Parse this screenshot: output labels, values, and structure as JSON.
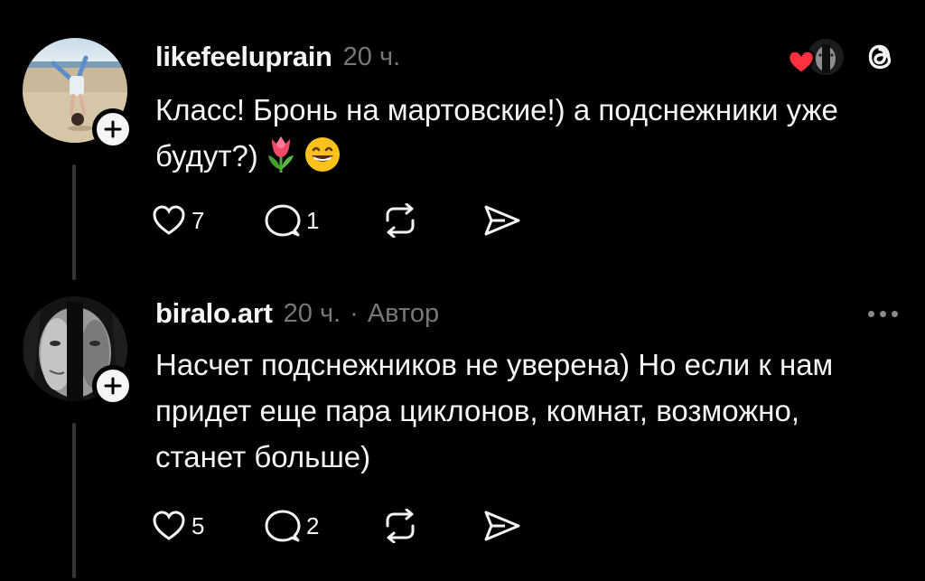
{
  "colors": {
    "background": "#000000",
    "text": "#f3f5f7",
    "secondary": "#777777",
    "heart": "#ff3040",
    "thread_line": "#333638"
  },
  "posts": [
    {
      "username": "likefeeluprain",
      "time": "20 ч.",
      "role": "",
      "text": "Класс! Бронь на мартовские!) а подснежники уже будут?)",
      "emojis": [
        "tulip",
        "grinning-face-with-smiling-eyes"
      ],
      "icons": [
        "heart-icon",
        "reply-icon",
        "repost-icon",
        "share-icon"
      ],
      "likes": "7",
      "replies": "1",
      "header_extras": [
        "liked-by-author-avatar",
        "threads-logo-icon"
      ]
    },
    {
      "username": "biralo.art",
      "time": "20 ч.",
      "separator": "·",
      "role": "Автор",
      "text": "Насчет подснежников не уверена) Но если к нам придет еще пара циклонов, комнат, возможно, станет больше)",
      "icons": [
        "heart-icon",
        "reply-icon",
        "repost-icon",
        "share-icon",
        "more-icon"
      ],
      "likes": "5",
      "replies": "2"
    }
  ]
}
